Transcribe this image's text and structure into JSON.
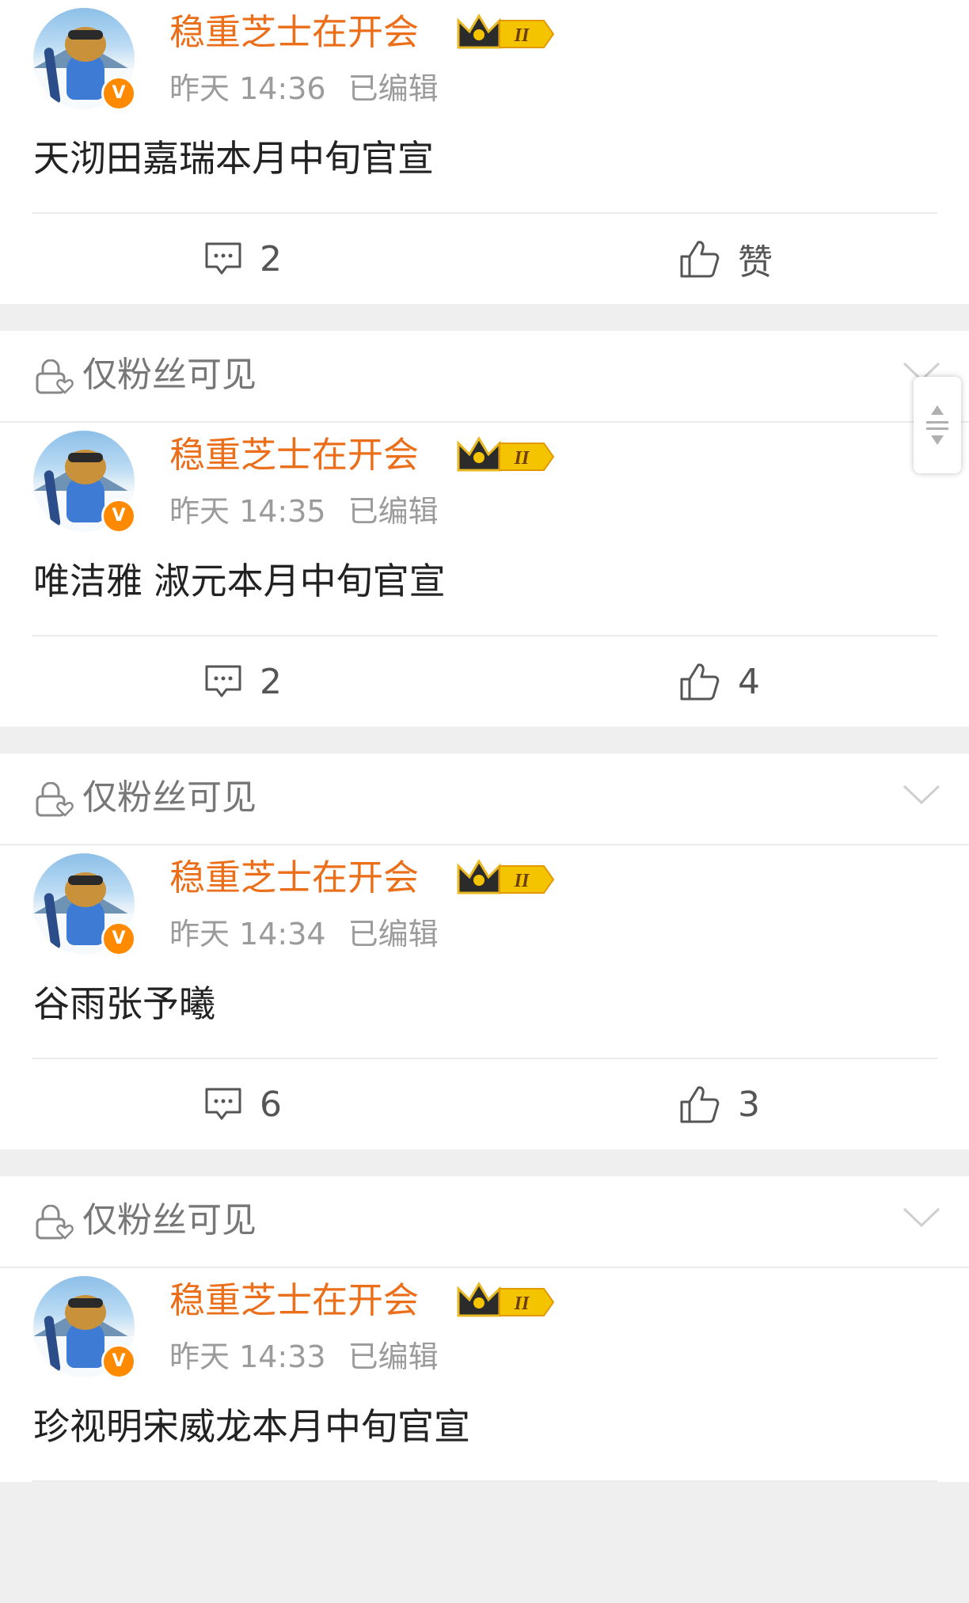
{
  "posts": [
    {
      "author": "稳重芝士在开会",
      "time": "昨天 14:36",
      "edited": "已编辑",
      "content": "天沏田嘉瑞本月中旬官宣",
      "comments": "2",
      "likes": "赞"
    },
    {
      "author": "稳重芝士在开会",
      "time": "昨天 14:35",
      "edited": "已编辑",
      "content": "唯洁雅 淑元本月中旬官宣",
      "comments": "2",
      "likes": "4"
    },
    {
      "author": "稳重芝士在开会",
      "time": "昨天 14:34",
      "edited": "已编辑",
      "content": "谷雨张予曦",
      "comments": "6",
      "likes": "3"
    },
    {
      "author": "稳重芝士在开会",
      "time": "昨天 14:33",
      "edited": "已编辑",
      "content": "珍视明宋威龙本月中旬官宣"
    }
  ],
  "visibility_label": "仅粉丝可见",
  "member_badge": "II",
  "verified_mark": "V",
  "icons": {
    "comment": "comment-icon",
    "like": "thumbs-up-icon",
    "lock": "lock-heart-icon",
    "expand": "chevron-down-icon",
    "verified": "verified-badge-icon",
    "crown": "crown-icon"
  },
  "colors": {
    "author": "#eb6f1a",
    "verified_badge": "#ff8a00",
    "background": "#efefef"
  }
}
